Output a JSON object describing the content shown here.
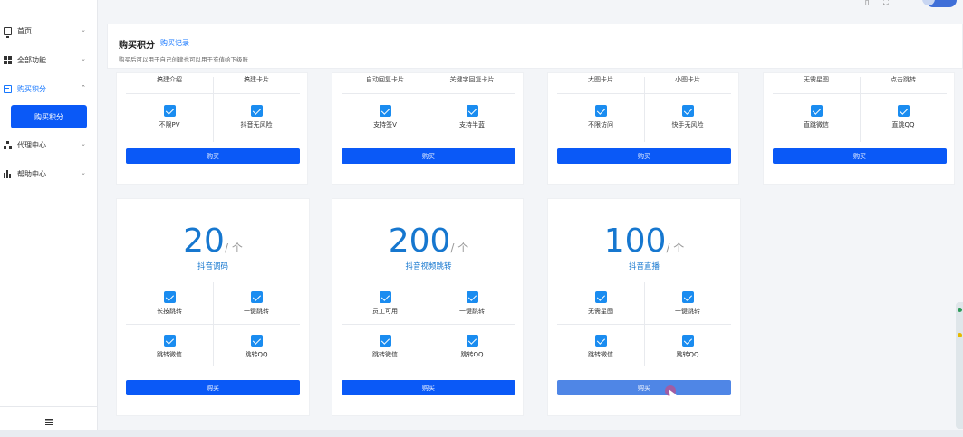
{
  "sidebar": {
    "items": [
      {
        "label": "首页",
        "icon": "monitor-icon"
      },
      {
        "label": "全部功能",
        "icon": "grid-icon"
      },
      {
        "label": "购买积分",
        "icon": "card-icon"
      },
      {
        "label": "代理中心",
        "icon": "org-tree-icon"
      },
      {
        "label": "帮助中心",
        "icon": "bar-chart-icon"
      }
    ],
    "active_sub": "购买积分"
  },
  "header": {
    "title": "购买积分",
    "link": "购买记录",
    "desc": "购买后可以用于自己创建也可以用于充值给下级账"
  },
  "top_cards": [
    {
      "labels_top": [
        "搞建介绍",
        "搞建卡片"
      ],
      "features": [
        "不限PV",
        "抖音无风险"
      ],
      "button": "购买"
    },
    {
      "labels_top": [
        "自动回复卡片",
        "关键字回复卡片"
      ],
      "features": [
        "支持签V",
        "支持半蓝"
      ],
      "button": "购买"
    },
    {
      "labels_top": [
        "大图卡片",
        "小图卡片"
      ],
      "features": [
        "不限访问",
        "快手无风险"
      ],
      "button": "购买"
    },
    {
      "labels_top": [
        "无需星图",
        "点击跳转"
      ],
      "features": [
        "直跳微信",
        "直跳QQ"
      ],
      "button": "购买"
    }
  ],
  "bottom_cards": [
    {
      "amount": "20",
      "unit": "/ 个",
      "name": "抖音调码",
      "features": [
        "长按跳转",
        "一键跳转",
        "跳转微信",
        "跳转QQ"
      ],
      "button": "购买"
    },
    {
      "amount": "200",
      "unit": "/ 个",
      "name": "抖音视频跳转",
      "features": [
        "员工可用",
        "一键跳转",
        "跳转微信",
        "跳转QQ"
      ],
      "button": "购买"
    },
    {
      "amount": "100",
      "unit": "/ 个",
      "name": "抖音直播",
      "features": [
        "无需星图",
        "一键跳转",
        "跳转微信",
        "跳转QQ"
      ],
      "button": "购买"
    }
  ],
  "colors": {
    "accent": "#0a59f7",
    "price": "#1677cf",
    "check": "#1a8cf0"
  }
}
